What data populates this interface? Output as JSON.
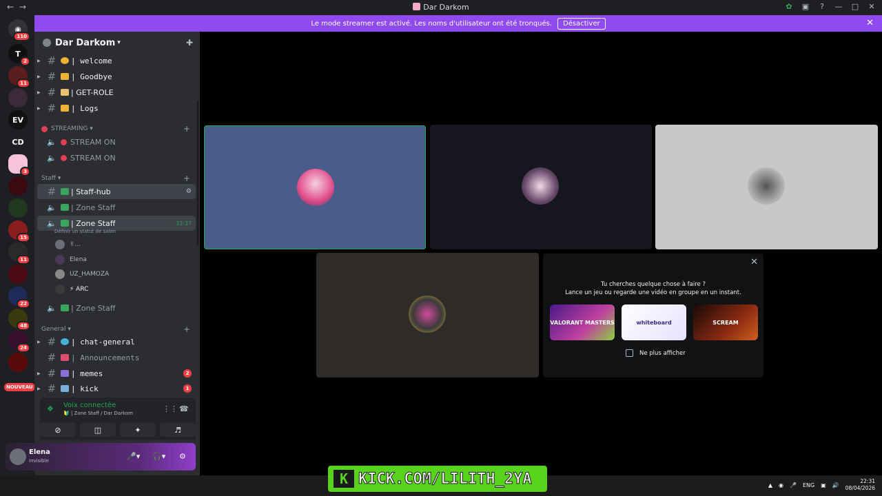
{
  "window": {
    "title": "Dar Darkom"
  },
  "banner": {
    "text": "Le mode streamer est activé. Les noms d'utilisateur ont été tronqués.",
    "button": "Désactiver"
  },
  "guilds": {
    "badges": [
      "110",
      "2",
      "11",
      "3",
      "15",
      "11",
      "22",
      "48",
      "24"
    ],
    "labels": {
      "cd": "CD",
      "ev": "EV",
      "t": "T"
    },
    "new_badge": "NOUVEAU"
  },
  "server": {
    "name": "Dar Darkom"
  },
  "channels": {
    "welcome": "| welcome",
    "goodbye": "| Goodbye",
    "getrole": "| GET-ROLE",
    "logs": "| Logs",
    "cat_streaming": "STREAMING",
    "stream1": "STREAM ON",
    "stream2": "STREAM ON",
    "cat_staff": "Staff",
    "staffhub": "| Staff-hub",
    "zone1": "| Zone Staff",
    "zone2": "| Zone Staff",
    "zone2_time": "33:37",
    "zone2_status": "Définir un statut de salon",
    "zone3": "| Zone Staff",
    "cat_general": "General",
    "chatgeneral": "| chat-general",
    "announcements": "| Announcements",
    "memes": "| memes",
    "memes_badge": "2",
    "kick": "| kick",
    "kick_badge": "1"
  },
  "voice_users": [
    "✌...",
    "Elena",
    "UZ_HAMOZA",
    "⚡ ARC"
  ],
  "voice_panel": {
    "title": "Voix connectée",
    "subtitle": "🔰 | Zone Staff / Dar Darkom"
  },
  "user_panel": {
    "name": "Elena",
    "status": "Invisible"
  },
  "activity": {
    "line1": "Tu cherches quelque chose à faire ?",
    "line2": "Lance un jeu ou regarde une vidéo en groupe en un instant.",
    "items": [
      "VALORANT MASTERS",
      "whiteboard",
      "SCREAM"
    ],
    "checkbox": "Ne plus afficher"
  },
  "overlay": {
    "kick": "KICK.COM/LILITH_2YA"
  },
  "tray": {
    "lang": "ENG",
    "time": "22:31",
    "date": "08/04/2026"
  },
  "colors": {
    "accent": "#8f4bf0",
    "online": "#23a55a",
    "badge": "#f23f43"
  }
}
